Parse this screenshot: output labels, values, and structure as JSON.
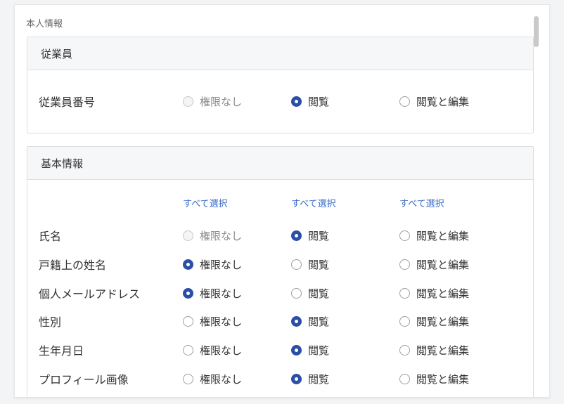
{
  "section_title": "本人情報",
  "options": {
    "none": "権限なし",
    "view": "閲覧",
    "edit": "閲覧と編集"
  },
  "employee_panel": {
    "title": "従業員",
    "rows": [
      {
        "label": "従業員番号",
        "selected": "view"
      }
    ]
  },
  "basic_panel": {
    "title": "基本情報",
    "select_all": [
      "すべて選択",
      "すべて選択",
      "すべて選択"
    ],
    "rows": [
      {
        "label": "氏名",
        "selected": "view"
      },
      {
        "label": "戸籍上の姓名",
        "selected": "none"
      },
      {
        "label": "個人メールアドレス",
        "selected": "none"
      },
      {
        "label": "性別",
        "selected": "view"
      },
      {
        "label": "生年月日",
        "selected": "view"
      },
      {
        "label": "プロフィール画像",
        "selected": "view"
      }
    ]
  },
  "colors": {
    "accent": "#2b4fa6",
    "link": "#3a6bc7",
    "panel_header_bg": "#f6f7f9"
  }
}
